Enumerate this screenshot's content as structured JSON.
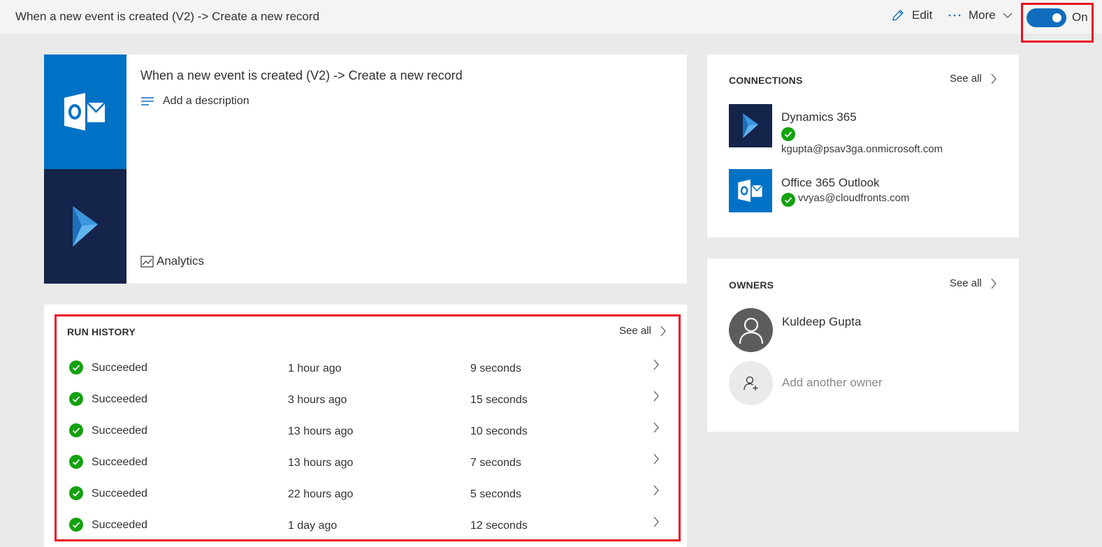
{
  "topbar": {
    "title": "When a new event is created (V2) -> Create a new record",
    "edit_label": "Edit",
    "more_label": "More",
    "toggle_label": "On",
    "toggle_on": true
  },
  "flow": {
    "title": "When a new event is created (V2) -> Create a new record",
    "description_placeholder": "Add a description",
    "analytics_label": "Analytics"
  },
  "run_history": {
    "header": "RUN HISTORY",
    "see_all": "See all",
    "rows": [
      {
        "status": "Succeeded",
        "when": "1 hour ago",
        "duration": "9 seconds"
      },
      {
        "status": "Succeeded",
        "when": "3 hours ago",
        "duration": "15 seconds"
      },
      {
        "status": "Succeeded",
        "when": "13 hours ago",
        "duration": "10 seconds"
      },
      {
        "status": "Succeeded",
        "when": "13 hours ago",
        "duration": "7 seconds"
      },
      {
        "status": "Succeeded",
        "when": "22 hours ago",
        "duration": "5 seconds"
      },
      {
        "status": "Succeeded",
        "when": "1 day ago",
        "duration": "12 seconds"
      }
    ]
  },
  "connections": {
    "header": "CONNECTIONS",
    "see_all": "See all",
    "items": [
      {
        "name": "Dynamics 365",
        "email": "kgupta@psav3ga.onmicrosoft.com",
        "icon": "dynamics-365-icon"
      },
      {
        "name": "Office 365 Outlook",
        "email": "vvyas@cloudfronts.com",
        "icon": "outlook-icon"
      }
    ]
  },
  "owners": {
    "header": "OWNERS",
    "see_all": "See all",
    "owner_name": "Kuldeep Gupta",
    "add_owner": "Add another owner"
  },
  "colors": {
    "accent": "#0f6cbd",
    "outlook_blue": "#0072c6",
    "dynamics_navy": "#14244a",
    "success_green": "#13a10e",
    "highlight_red": "#e81123"
  }
}
